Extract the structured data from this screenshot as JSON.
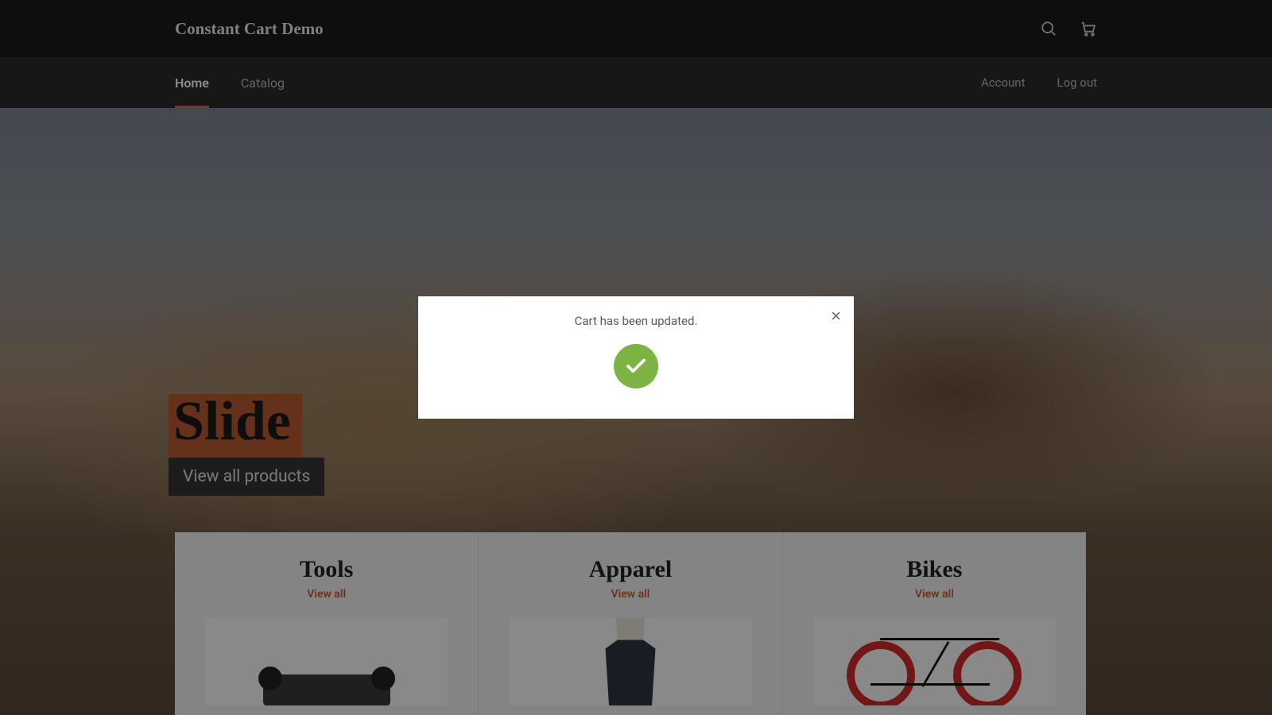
{
  "header": {
    "site_title": "Constant Cart Demo",
    "search_icon": "search-icon",
    "cart_icon": "cart-icon"
  },
  "nav": {
    "left": [
      {
        "label": "Home",
        "active": true
      },
      {
        "label": "Catalog",
        "active": false
      }
    ],
    "right": [
      {
        "label": "Account"
      },
      {
        "label": "Log out"
      }
    ]
  },
  "hero": {
    "title": "Slide",
    "subtitle": "View all products"
  },
  "categories": [
    {
      "title": "Tools",
      "link_label": "View all"
    },
    {
      "title": "Apparel",
      "link_label": "View all"
    },
    {
      "title": "Bikes",
      "link_label": "View all"
    }
  ],
  "modal": {
    "message": "Cart has been updated.",
    "close_label": "×",
    "status_color": "#7cb342"
  }
}
